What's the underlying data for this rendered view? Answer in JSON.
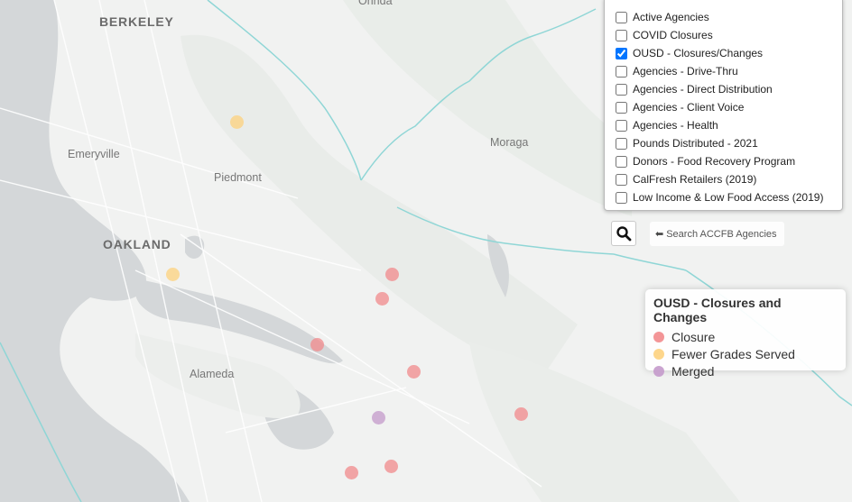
{
  "places": [
    {
      "name": "Orinda",
      "style": "mid"
    },
    {
      "name": "BERKELEY",
      "style": "bold"
    },
    {
      "name": "Emeryville",
      "style": "mid"
    },
    {
      "name": "Piedmont",
      "style": "mid"
    },
    {
      "name": "OAKLAND",
      "style": "bold"
    },
    {
      "name": "Moraga",
      "style": "mid"
    },
    {
      "name": "Alameda",
      "style": "mid"
    }
  ],
  "layers": [
    {
      "label": "Active Agencies",
      "checked": false
    },
    {
      "label": "COVID Closures",
      "checked": false
    },
    {
      "label": "OUSD - Closures/Changes",
      "checked": true
    },
    {
      "label": "Agencies - Drive-Thru",
      "checked": false
    },
    {
      "label": "Agencies - Direct Distribution",
      "checked": false
    },
    {
      "label": "Agencies - Client Voice",
      "checked": false
    },
    {
      "label": "Agencies - Health",
      "checked": false
    },
    {
      "label": "Pounds Distributed - 2021",
      "checked": false
    },
    {
      "label": "Donors - Food Recovery Program",
      "checked": false
    },
    {
      "label": "CalFresh Retailers (2019)",
      "checked": false
    },
    {
      "label": "Low Income & Low Food Access (2019)",
      "checked": false
    }
  ],
  "search": {
    "hint": "Search ACCFB Agencies"
  },
  "legend": {
    "title": "OUSD - Closures and Changes",
    "items": [
      {
        "label": "Closure",
        "color": "#f28a8c"
      },
      {
        "label": "Fewer Grades Served",
        "color": "#fdd27e"
      },
      {
        "label": "Merged",
        "color": "#c49acb"
      }
    ]
  },
  "markers": [
    {
      "category": "Fewer Grades Served"
    },
    {
      "category": "Fewer Grades Served"
    },
    {
      "category": "Closure"
    },
    {
      "category": "Closure"
    },
    {
      "category": "Closure"
    },
    {
      "category": "Closure"
    },
    {
      "category": "Closure"
    },
    {
      "category": "Merged"
    },
    {
      "category": "Closure"
    },
    {
      "category": "Closure"
    }
  ],
  "colors": {
    "land": "#f1f2f1",
    "water": "#d3d6d8",
    "parks": "#e8ece8",
    "boundary": "#8fd6d6"
  }
}
